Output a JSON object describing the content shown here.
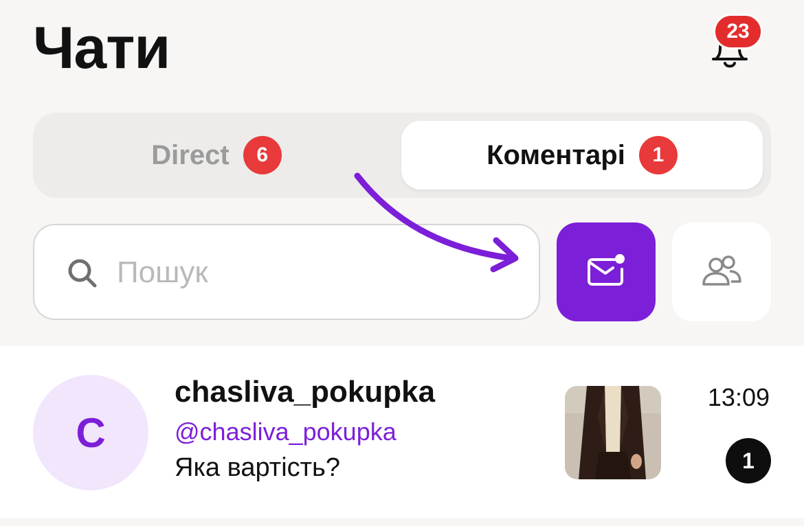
{
  "header": {
    "title": "Чати",
    "notifications_count": "23",
    "bell_icon": "bell-icon"
  },
  "tabs": [
    {
      "label": "Direct",
      "badge": "6",
      "active": false
    },
    {
      "label": "Коментарі",
      "badge": "1",
      "active": true
    }
  ],
  "search": {
    "placeholder": "Пошук",
    "value": "",
    "icon": "search-icon"
  },
  "filters": {
    "mail_icon": "mail-unread-icon",
    "people_icon": "people-icon"
  },
  "chats": [
    {
      "avatar_letter": "C",
      "name": "chasliva_pokupka",
      "handle": "@chasliva_pokupka",
      "message": "Яка вартість?",
      "time": "13:09",
      "unread": "1"
    }
  ],
  "colors": {
    "accent": "#7c1fd8",
    "badge_red": "#e32d2d",
    "background": "#f7f6f4",
    "avatar_bg": "#f1e6fc"
  }
}
